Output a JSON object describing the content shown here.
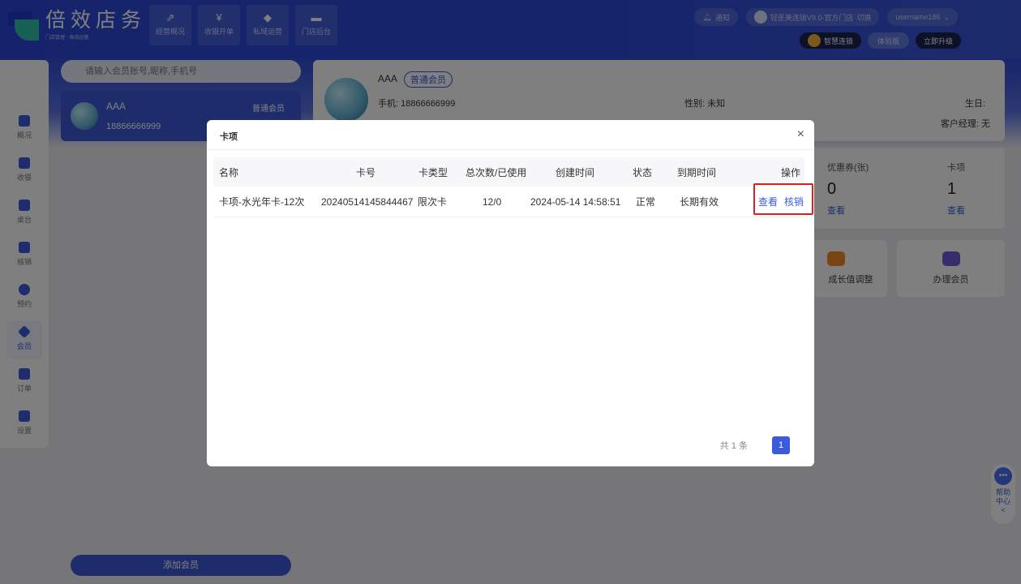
{
  "app": {
    "brand_name": "倍效店务",
    "brand_tagline": "门店管理 · 高效运营",
    "nav": [
      {
        "label": "经营概况",
        "icon": "chart-icon"
      },
      {
        "label": "收银开单",
        "icon": "yen-icon"
      },
      {
        "label": "私域运营",
        "icon": "diamond-icon"
      },
      {
        "label": "门店后台",
        "icon": "card-icon"
      }
    ],
    "notify_label": "通知",
    "store_label": "轻医美连锁V9.0-官方门店",
    "switch_label": "切换",
    "username": "username186",
    "smart_label": "智慧连锁",
    "trial_label": "体验版",
    "upgrade_label": "立即升级"
  },
  "sidebar": {
    "items": [
      {
        "label": "概况",
        "icon": "trend-icon"
      },
      {
        "label": "收银",
        "icon": "yen-icon"
      },
      {
        "label": "桌台",
        "icon": "table-icon"
      },
      {
        "label": "核销",
        "icon": "verify-icon"
      },
      {
        "label": "预约",
        "icon": "clock-icon"
      },
      {
        "label": "会员",
        "icon": "diamond-icon",
        "active": true
      },
      {
        "label": "订单",
        "icon": "order-icon"
      },
      {
        "label": "设置",
        "icon": "gear-icon"
      }
    ]
  },
  "search": {
    "placeholder": "请输入会员账号,昵称,手机号"
  },
  "member_card": {
    "name": "AAA",
    "phone": "18866666999",
    "level": "普通会员"
  },
  "detail": {
    "name": "AAA",
    "level": "普通会员",
    "phone": "手机: 18866666999",
    "gender": "性别: 未知",
    "birthday": "生日:",
    "manager": "客户经理: 无"
  },
  "stats": [
    {
      "label": "优惠券(张)",
      "value": "0",
      "link": "查看"
    },
    {
      "label": "卡项",
      "value": "1",
      "link": "查看"
    }
  ],
  "tiles": [
    {
      "label": "成长值调整"
    },
    {
      "label": "办理会员"
    }
  ],
  "add_member_label": "添加会员",
  "help": {
    "label": "帮助中心",
    "arrow": "<"
  },
  "modal": {
    "title": "卡项",
    "close": "×",
    "columns": [
      "名称",
      "卡号",
      "卡类型",
      "总次数/已使用",
      "创建时间",
      "状态",
      "到期时间",
      "操作"
    ],
    "rows": [
      {
        "name": "卡项-水光年卡-12次",
        "card_no": "20240514145844467",
        "type": "限次卡",
        "usage": "12/0",
        "created": "2024-05-14 14:58:51",
        "status": "正常",
        "expiry": "长期有效",
        "action_view": "查看",
        "action_verify": "核销"
      }
    ],
    "total_text": "共 1 条",
    "current_page": "1"
  },
  "colors": {
    "accent": "#3b5bdb",
    "highlight_border": "#e02020"
  }
}
